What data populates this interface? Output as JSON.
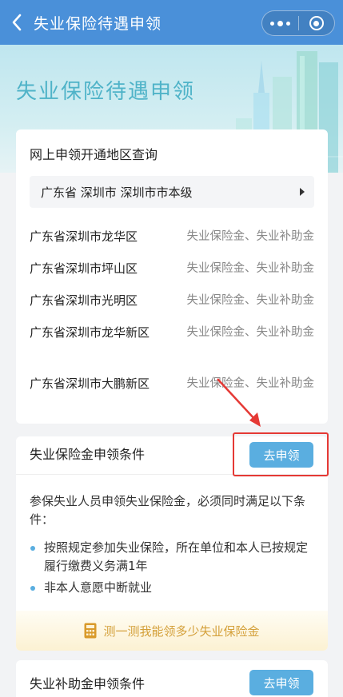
{
  "navbar": {
    "title": "失业保险待遇申领",
    "back_icon": "chevron-left-icon",
    "more_icon": "more-dots-icon",
    "close_icon": "target-circle-icon"
  },
  "hero": {
    "title": "失业保险待遇申领"
  },
  "region_query": {
    "heading": "网上申领开通地区查询",
    "selected_region": "广东省 深圳市 深圳市市本级",
    "rows": [
      {
        "area": "广东省深圳市龙华区",
        "types": "失业保险金、失业补助金"
      },
      {
        "area": "广东省深圳市坪山区",
        "types": "失业保险金、失业补助金"
      },
      {
        "area": "广东省深圳市光明区",
        "types": "失业保险金、失业补助金"
      },
      {
        "area": "广东省深圳市龙华新区",
        "types": "失业保险金、失业补助金"
      },
      {
        "area": "广东省深圳市大鹏新区",
        "types": "失业保险金、失业补助金"
      }
    ]
  },
  "unemployment_benefit": {
    "heading": "失业保险金申领条件",
    "apply_label": "去申领",
    "description": "参保失业人员申领失业保险金，必须同时满足以下条件：",
    "conditions": [
      "按照规定参加失业保险，所在单位和本人已按规定履行缴费义务满1年",
      "非本人意愿中断就业"
    ],
    "calculator_label": "测一测我能领多少失业保险金"
  },
  "subsidy": {
    "heading": "失业补助金申领条件",
    "apply_label": "去申领"
  },
  "colors": {
    "nav_bg": "#4a90d9",
    "accent_button": "#5aaee0",
    "hero_title": "#4fb3c8",
    "calculator_text": "#d4a03a",
    "annotation_red": "#e53935"
  }
}
